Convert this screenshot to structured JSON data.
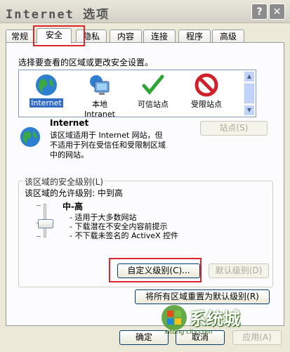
{
  "window": {
    "title": "Internet 选项",
    "help_button": "?",
    "close_button": "✕"
  },
  "tabs": [
    {
      "label": "常规"
    },
    {
      "label": "安全"
    },
    {
      "label": "隐私"
    },
    {
      "label": "内容"
    },
    {
      "label": "连接"
    },
    {
      "label": "程序"
    },
    {
      "label": "高级"
    }
  ],
  "security": {
    "instruction": "选择要查看的区域或更改安全设置。",
    "zones": [
      {
        "label": "Internet",
        "icon": "globe-icon"
      },
      {
        "label": "本地\nIntranet",
        "icon": "computer-icon"
      },
      {
        "label": "可信站点",
        "icon": "checkmark-icon"
      },
      {
        "label": "受限站点",
        "icon": "no-entry-icon"
      }
    ],
    "zone_heading": "Internet",
    "zone_description": "该区域适用于 Internet 网站，但\n不适用于列在受信任和受限制区域\n中的网站。",
    "sites_button": "站点(S)",
    "level_group_title": "该区域的安全级别(L)",
    "allowed_levels": "该区域的允许级别: 中到高",
    "level_name": "中-高",
    "level_bullets": [
      "- 适用于大多数网站",
      "- 下载潜在不安全内容前提示",
      "- 不下载未签名的 ActiveX 控件"
    ],
    "custom_level_button": "自定义级别(C)...",
    "default_level_button": "默认级别(D)",
    "reset_all_button": "将所有区域重置为默认级别(R)"
  },
  "footer": {
    "ok": "确定",
    "cancel": "取消",
    "apply": "应用(A)"
  },
  "watermark": {
    "brand": "系统城",
    "url": "xitong city.com"
  },
  "colors": {
    "highlight_red": "#e0262d",
    "selection_blue": "#316ac5"
  }
}
